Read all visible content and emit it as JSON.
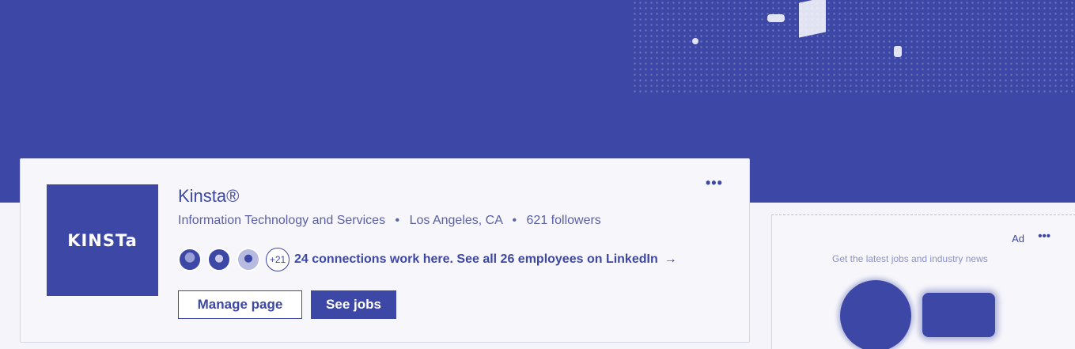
{
  "colors": {
    "brand": "#3d47a5",
    "background": "#f4f4fa",
    "card": "#f7f7fb",
    "muted_text": "#5a5fa6"
  },
  "company": {
    "name": "Kinsta®",
    "logo_text": "KINSTa",
    "industry": "Information Technology and Services",
    "location": "Los Angeles, CA",
    "followers": "621 followers",
    "separator": "•",
    "more_icon": "more-horizontal-icon",
    "more_label": "•••"
  },
  "connections": {
    "more_count": "+21",
    "link_text": "24 connections work here. See all 26 employees on LinkedIn",
    "arrow": "→"
  },
  "actions": {
    "manage_label": "Manage page",
    "jobs_label": "See jobs"
  },
  "ad": {
    "label": "Ad",
    "more_label": "•••",
    "text": "Get the latest jobs and industry news"
  }
}
